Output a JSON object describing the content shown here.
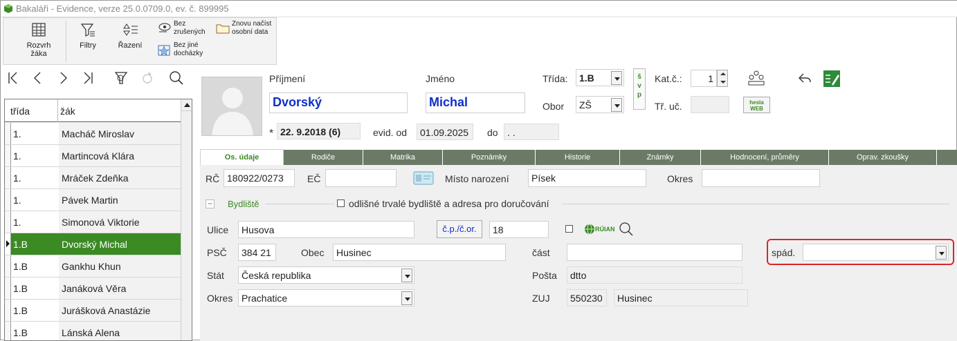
{
  "window": {
    "title": "Bakaláři - Evidence, verze 25.0.0709.0, ev. č. 899995"
  },
  "toolbar": {
    "rozvrh": "Rozvrh\nžáka",
    "rozvrh_l1": "Rozvrh",
    "rozvrh_l2": "žáka",
    "filtry": "Filtry",
    "razeni": "Řazení",
    "bez_zrusenych_l1": "Bez",
    "bez_zrusenych_l2": "zrušených",
    "bez_jine_l1": "Bez jiné",
    "bez_jine_l2": "docházky",
    "znovu_l1": "Znovu načíst",
    "znovu_l2": "osobní data"
  },
  "list": {
    "col_trida": "třída",
    "col_zak": "žák",
    "rows": [
      {
        "trida": "1.",
        "zak": "Macháč Miroslav"
      },
      {
        "trida": "1.",
        "zak": "Martincová Klára"
      },
      {
        "trida": "1.",
        "zak": "Mráček Zdeňka"
      },
      {
        "trida": "1.",
        "zak": "Pávek Martin"
      },
      {
        "trida": "1.",
        "zak": "Simonová Viktorie"
      },
      {
        "trida": "1.B",
        "zak": "Dvorský Michal"
      },
      {
        "trida": "1.B",
        "zak": "Gankhu Khun"
      },
      {
        "trida": "1.B",
        "zak": "Janáková Věra"
      },
      {
        "trida": "1.B",
        "zak": "Jurášková Anastázie"
      },
      {
        "trida": "1.B",
        "zak": "Lánská Alena"
      }
    ]
  },
  "student": {
    "prijmeni_label": "Příjmení",
    "prijmeni": "Dvorský",
    "jmeno_label": "Jméno",
    "jmeno": "Michal",
    "birth_mark": "*",
    "narozen": "22. 9.2018 (6)",
    "evid_od_label": "evid. od",
    "evid_od": "01.09.2025",
    "do_label": "do",
    "do": " . .",
    "trida_label": "Třída:",
    "trida": "1.B",
    "obor_label": "Obor",
    "obor": "ZŠ",
    "svp": [
      "š",
      "v",
      "p"
    ],
    "kat_label": "Kat.č.:",
    "kat": "1",
    "tr_uc_label": "Tř. uč.",
    "tr_uc": "",
    "hesla_l1": "hesla",
    "hesla_l2": "WEB"
  },
  "tabs": [
    "Os. údaje",
    "Rodiče",
    "Matrika",
    "Poznámky",
    "Historie",
    "Známky",
    "Hodnocení, průměry",
    "Oprav. zkoušky"
  ],
  "os_udaje": {
    "rc_label": "RČ",
    "rc": "180922/0273",
    "ec_label": "EČ",
    "ec": "",
    "misto_label": "Místo narození",
    "misto": "Písek",
    "okres_label": "Okres",
    "okres": "",
    "collapse_mark": "−",
    "bydliste_label": "Bydliště",
    "odlisne_label": "odlišné trvalé bydliště a adresa pro doručování",
    "ulice_label": "Ulice",
    "ulice": "Husova",
    "cp_button": "č.p./č.or.",
    "cp": "18",
    "ruian": "RÚIAN",
    "psc_label": "PSČ",
    "psc": "384 21",
    "obec_label": "Obec",
    "obec": "Husinec",
    "cast_label": "část",
    "cast": "",
    "spad_label": "spád.",
    "spad": "",
    "stat_label": "Stát",
    "stat": "Česká republika",
    "posta_label": "Pošta",
    "posta": "dtto",
    "okres2_label": "Okres",
    "okres2": "Prachatice",
    "zuj_label": "ZUJ",
    "zuj_code": "550230",
    "zuj_name": "Husinec"
  },
  "colors": {
    "accent_green": "#3b8a24",
    "tab_gray": "#6b7a66",
    "name_blue": "#0f2fc8",
    "highlight_red": "#d9262b"
  }
}
